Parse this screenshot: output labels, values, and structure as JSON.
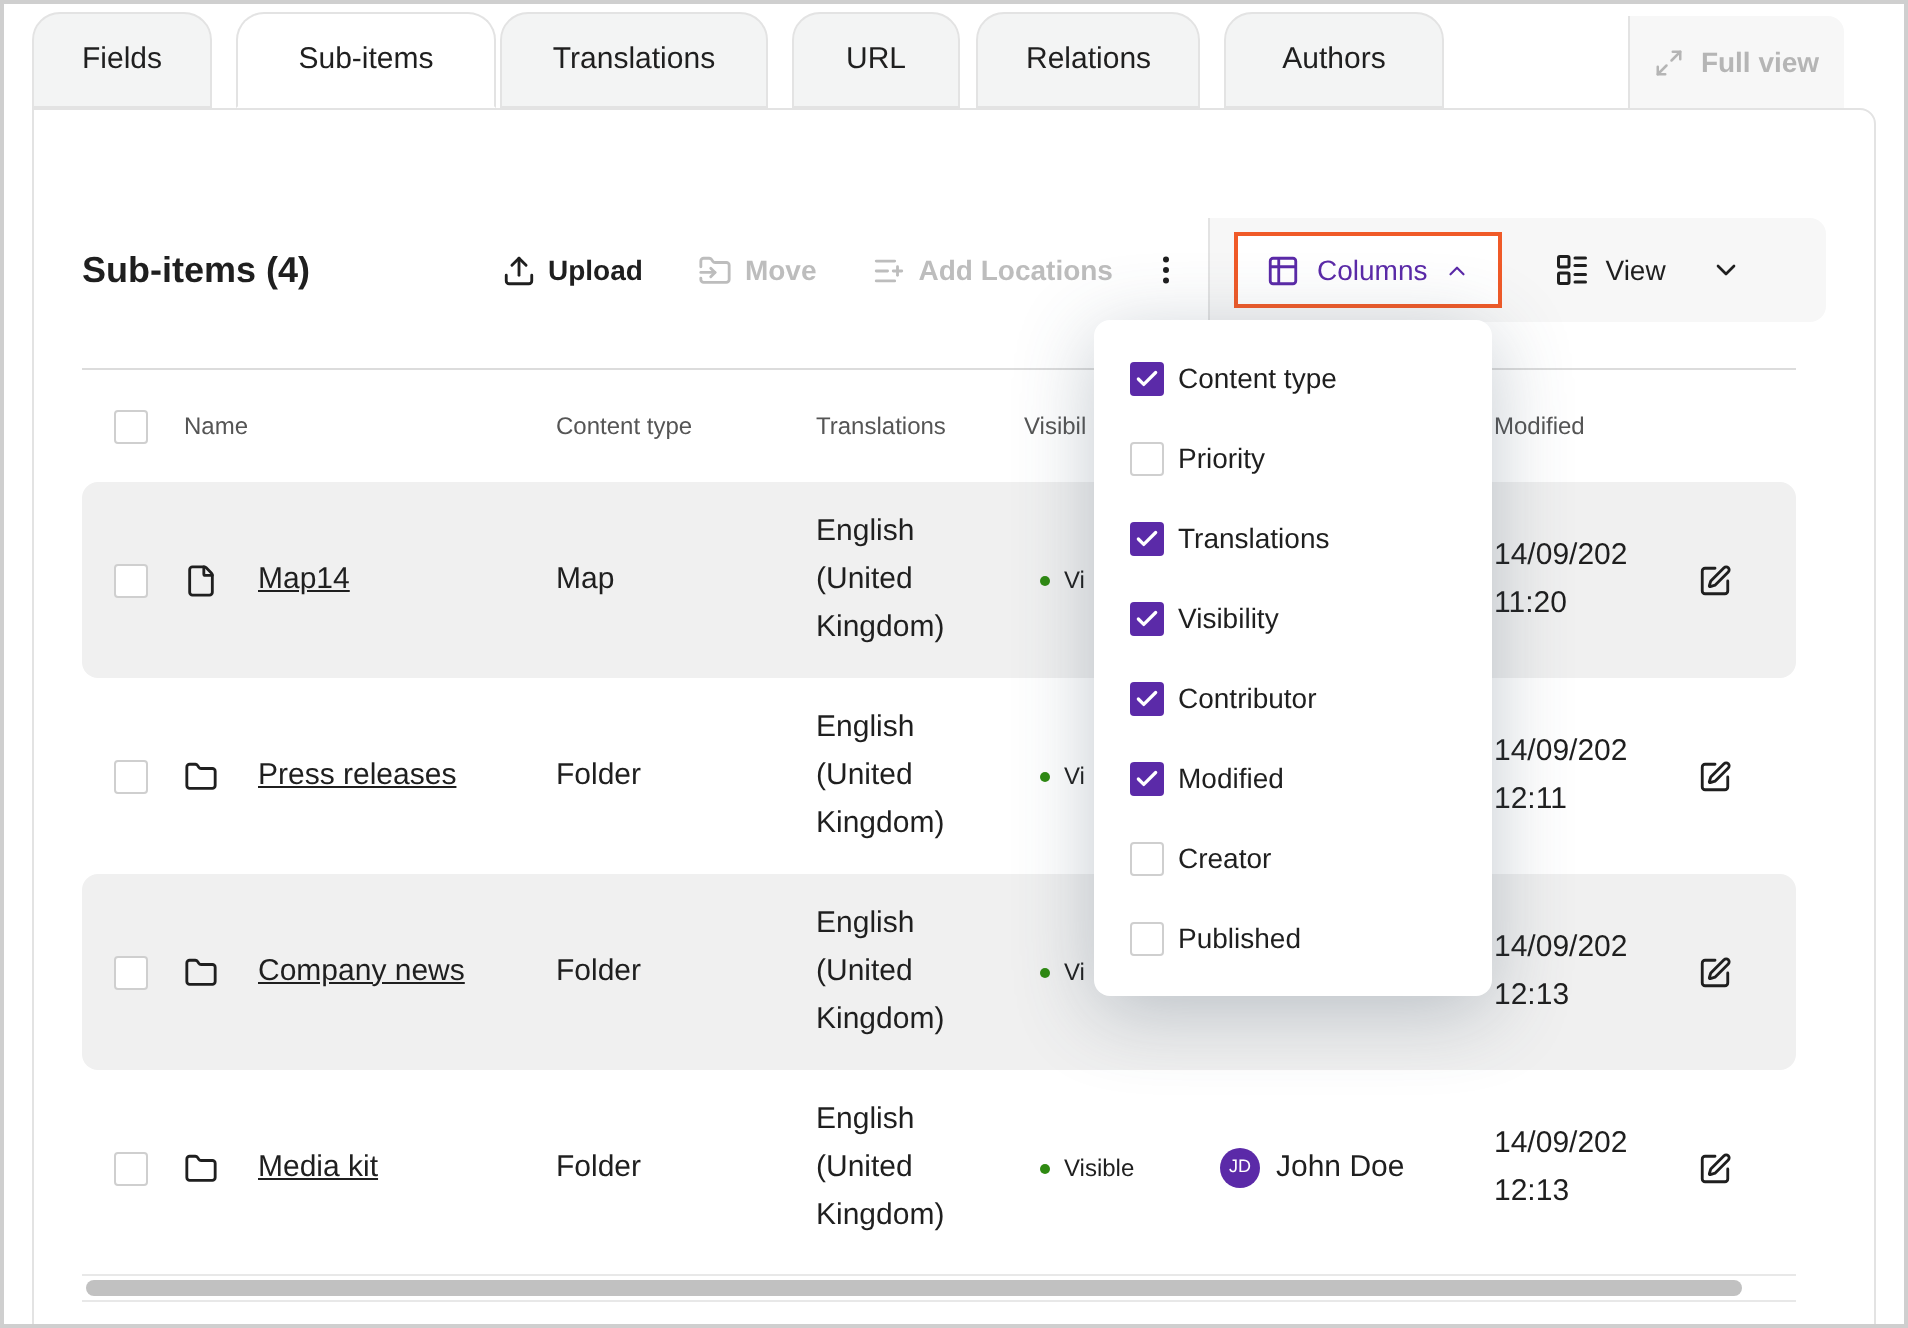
{
  "tabs": [
    {
      "label": "Fields",
      "selected": false
    },
    {
      "label": "Sub-items",
      "selected": true
    },
    {
      "label": "Translations",
      "selected": false
    },
    {
      "label": "URL",
      "selected": false
    },
    {
      "label": "Relations",
      "selected": false
    },
    {
      "label": "Authors",
      "selected": false
    }
  ],
  "full_view": {
    "label": "Full view",
    "disabled": true
  },
  "toolbar": {
    "title": "Sub-items (4)",
    "actions": [
      {
        "kind": "upload",
        "label": "Upload",
        "disabled": false
      },
      {
        "kind": "move",
        "label": "Move",
        "disabled": true
      },
      {
        "kind": "locations",
        "label": "Add Locations",
        "disabled": true
      }
    ],
    "columns_button": {
      "label": "Columns",
      "expanded": true
    },
    "view_button": {
      "label": "View"
    }
  },
  "columns_menu": [
    {
      "label": "Content type",
      "checked": true
    },
    {
      "label": "Priority",
      "checked": false
    },
    {
      "label": "Translations",
      "checked": true
    },
    {
      "label": "Visibility",
      "checked": true
    },
    {
      "label": "Contributor",
      "checked": true
    },
    {
      "label": "Modified",
      "checked": true
    },
    {
      "label": "Creator",
      "checked": false
    },
    {
      "label": "Published",
      "checked": false
    }
  ],
  "table": {
    "select_all_checked": false,
    "columns": [
      "Name",
      "Content type",
      "Translations",
      "Visibil",
      "Modified"
    ],
    "rows": [
      {
        "kind": "file",
        "checked": false,
        "name": "Map14",
        "content_type": "Map",
        "translation": "English (United Kingdom)",
        "visibility": "Vi",
        "date": "14/09/202",
        "time": "11:20"
      },
      {
        "kind": "folder",
        "checked": false,
        "name": "Press releases",
        "content_type": "Folder",
        "translation": "English (United Kingdom)",
        "visibility": "Vi",
        "date": "14/09/202",
        "time": "12:11"
      },
      {
        "kind": "folder",
        "checked": false,
        "name": "Company news",
        "content_type": "Folder",
        "translation": "English (United Kingdom)",
        "visibility": "Vi",
        "date": "14/09/202",
        "time": "12:13"
      },
      {
        "kind": "folder",
        "checked": false,
        "name": "Media kit",
        "content_type": "Folder",
        "translation": "English (United Kingdom)",
        "visibility": "Visible",
        "contributor": {
          "initials": "JD",
          "name": "John Doe"
        },
        "date": "14/09/202",
        "time": "12:13"
      }
    ]
  }
}
